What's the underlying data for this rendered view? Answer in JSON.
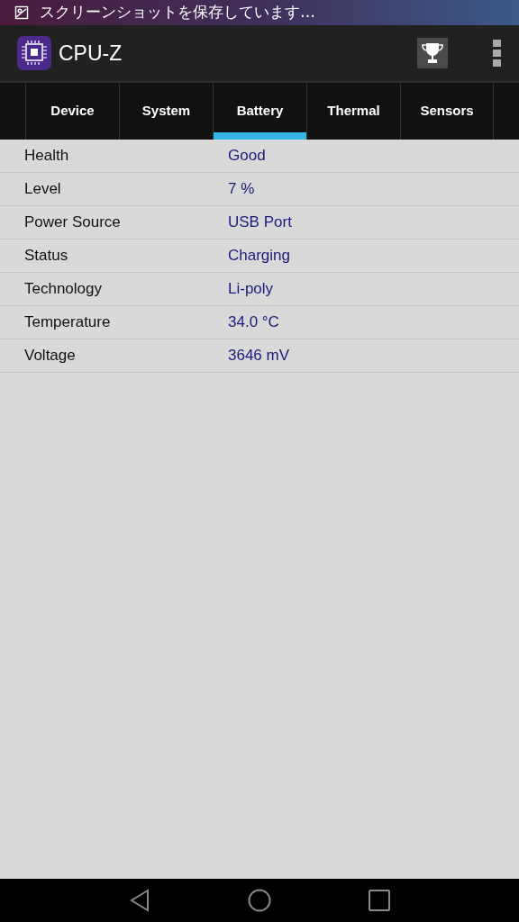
{
  "notification": {
    "text": "スクリーンショットを保存しています…"
  },
  "app_bar": {
    "title": "CPU-Z"
  },
  "tabs": [
    {
      "label": "Device",
      "selected": false
    },
    {
      "label": "System",
      "selected": false
    },
    {
      "label": "Battery",
      "selected": true
    },
    {
      "label": "Thermal",
      "selected": false
    },
    {
      "label": "Sensors",
      "selected": false
    }
  ],
  "rows": [
    {
      "label": "Health",
      "value": "Good"
    },
    {
      "label": "Level",
      "value": "7 %"
    },
    {
      "label": "Power Source",
      "value": "USB Port"
    },
    {
      "label": "Status",
      "value": "Charging"
    },
    {
      "label": "Technology",
      "value": "Li-poly"
    },
    {
      "label": "Temperature",
      "value": "34.0 °C"
    },
    {
      "label": "Voltage",
      "value": "3646 mV"
    }
  ]
}
